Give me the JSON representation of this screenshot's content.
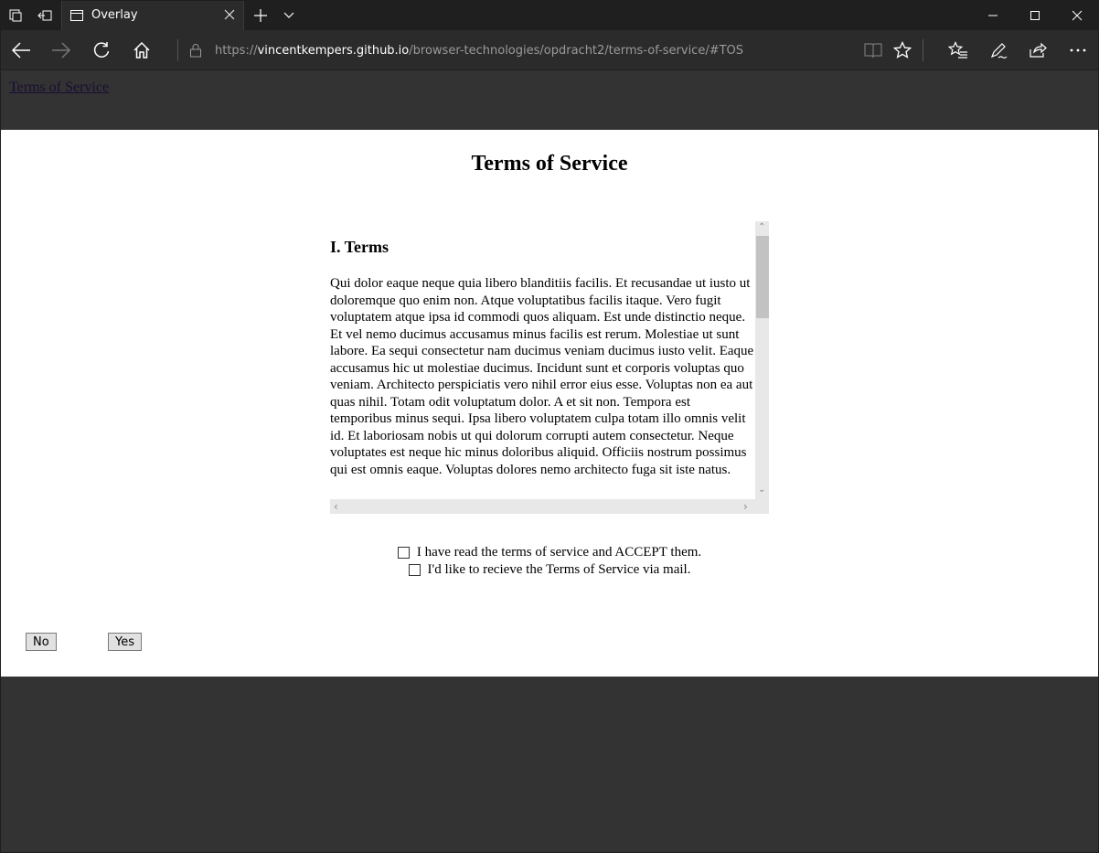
{
  "browser": {
    "tab_title": "Overlay",
    "url_scheme": "https://",
    "url_host": "vincentkempers.github.io",
    "url_path": "/browser-technologies/opdracht2/terms-of-service/#TOS"
  },
  "page": {
    "top_link": "Terms of Service",
    "overlay": {
      "title": "Terms of Service",
      "section_heading": "I. Terms",
      "section_text": "Qui dolor eaque neque quia libero blanditiis facilis. Et recusandae ut iusto ut doloremque quo enim non. Atque voluptatibus facilis itaque. Vero fugit voluptatem atque ipsa id commodi quos aliquam. Est unde distinctio neque. Et vel nemo ducimus accusamus minus facilis est rerum. Molestiae ut sunt labore. Ea sequi consectetur nam ducimus veniam ducimus iusto velit. Eaque accusamus hic ut molestiae ducimus. Incidunt sunt et corporis voluptas quo veniam. Architecto perspiciatis vero nihil error eius esse. Voluptas non ea aut quas nihil. Totam odit voluptatum dolor. A et sit non. Tempora est temporibus minus sequi. Ipsa libero voluptatem culpa totam illo omnis velit id. Et laboriosam nobis ut qui dolorum corrupti autem consectetur. Neque voluptates est neque hic minus doloribus aliquid. Officiis nostrum possimus qui est omnis eaque. Voluptas dolores nemo architecto fuga sit iste natus.",
      "checkbox_accept_label": "I have read the terms of service and ACCEPT them.",
      "checkbox_mail_label": "I'd like to recieve the Terms of Service via mail.",
      "no_button": "No",
      "yes_button": "Yes"
    }
  }
}
